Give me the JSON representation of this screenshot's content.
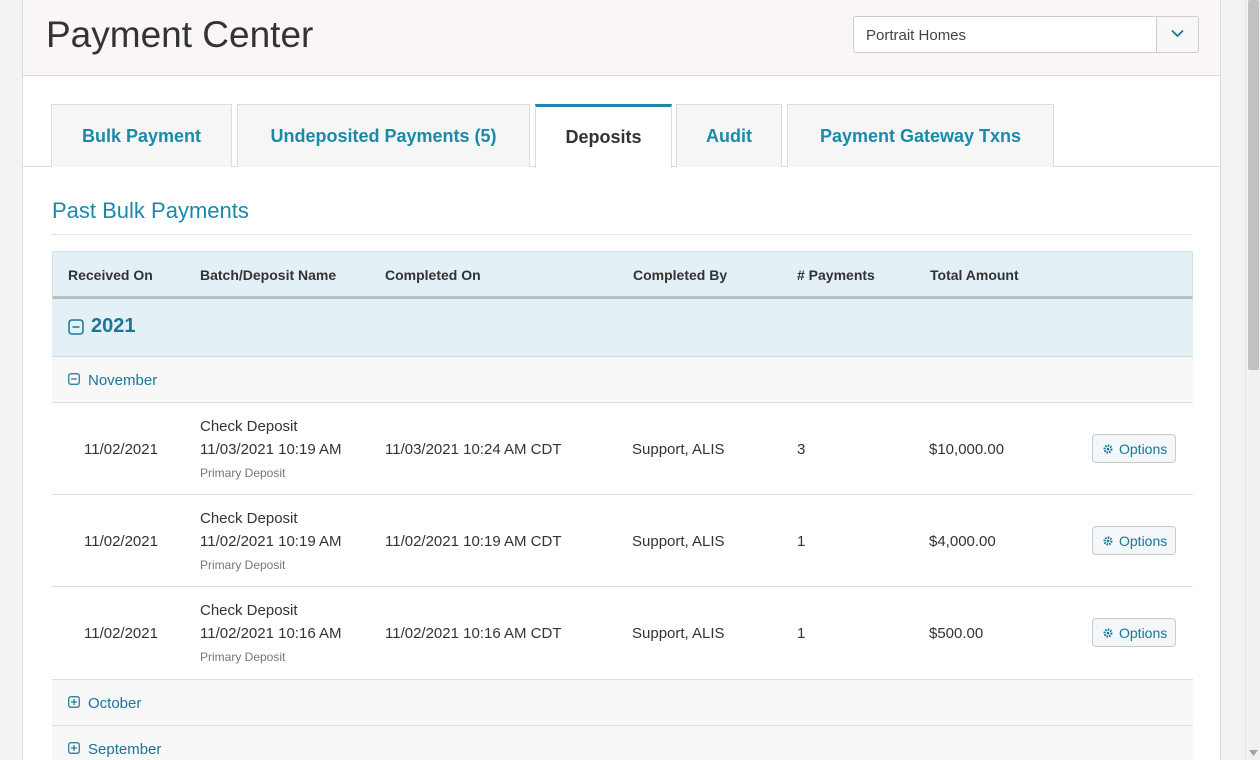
{
  "header": {
    "title": "Payment Center",
    "company_select": {
      "value": "Portrait Homes"
    }
  },
  "tabs": [
    {
      "label": "Bulk Payment",
      "active": false
    },
    {
      "label": "Undeposited Payments (5)",
      "active": false
    },
    {
      "label": "Deposits",
      "active": true
    },
    {
      "label": "Audit",
      "active": false
    },
    {
      "label": "Payment Gateway Txns",
      "active": false
    }
  ],
  "section": {
    "title": "Past Bulk Payments"
  },
  "table": {
    "columns": [
      "Received On",
      "Batch/Deposit Name",
      "Completed On",
      "Completed By",
      "# Payments",
      "Total Amount"
    ],
    "year": "2021",
    "month": "November",
    "rows": [
      {
        "received_on": "11/02/2021",
        "batch_name": "Check Deposit",
        "batch_date": "11/03/2021 10:19 AM",
        "batch_note": "Primary Deposit",
        "completed_on": "11/03/2021 10:24 AM CDT",
        "completed_by": "Support, ALIS",
        "payments": "3",
        "total": "$10,000.00",
        "action": "Options"
      },
      {
        "received_on": "11/02/2021",
        "batch_name": "Check Deposit",
        "batch_date": "11/02/2021 10:19 AM",
        "batch_note": "Primary Deposit",
        "completed_on": "11/02/2021 10:19 AM CDT",
        "completed_by": "Support, ALIS",
        "payments": "1",
        "total": "$4,000.00",
        "action": "Options"
      },
      {
        "received_on": "11/02/2021",
        "batch_name": "Check Deposit",
        "batch_date": "11/02/2021 10:16 AM",
        "batch_note": "Primary Deposit",
        "completed_on": "11/02/2021 10:16 AM CDT",
        "completed_by": "Support, ALIS",
        "payments": "1",
        "total": "$500.00",
        "action": "Options"
      }
    ],
    "collapsed_months": [
      "October",
      "September"
    ]
  },
  "colors": {
    "accent": "#1a8aa8",
    "header_bg": "#e3f0f5"
  },
  "icons": {
    "collapse": "minus-square-icon",
    "expand": "plus-square-icon",
    "options": "gear-icon",
    "dropdown": "chevron-down-icon"
  }
}
